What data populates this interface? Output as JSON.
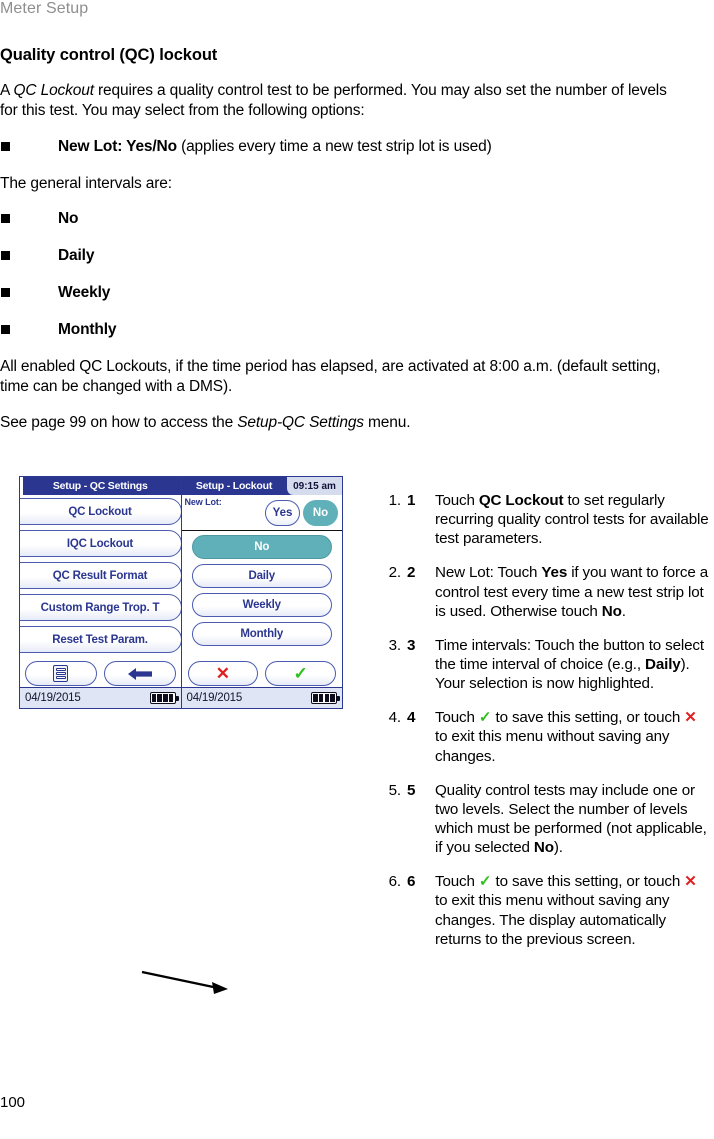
{
  "header": {
    "running_title": "Meter Setup"
  },
  "page_number": "100",
  "section": {
    "title": "Quality control (QC) lockout",
    "intro_a": "A ",
    "intro_italic": "QC Lockout",
    "intro_b": " requires a quality control test to be performed. You may also set the number of levels for this test. You may select from the following options:",
    "bullet_newlot_label": "New Lot: Yes/No",
    "bullet_newlot_tail": " (applies every time a new test strip lot is used)",
    "intervals_lead": "The general intervals are:",
    "intervals": [
      "No",
      "Daily",
      "Weekly",
      "Monthly"
    ],
    "note": "All enabled QC Lockouts, if the time period has elapsed, are activated at 8:00 a.m. (default setting, time can be changed with a DMS).",
    "seealso_a": "See page 99 on how to access the ",
    "seealso_italic": "Setup-QC Settings",
    "seealso_b": " menu."
  },
  "device": {
    "left_screen": {
      "title": "Setup - QC Settings",
      "menu_items": [
        "QC Lockout",
        "IQC Lockout",
        "QC Result Format",
        "Custom Range Trop. T",
        "Reset Test Param."
      ],
      "nav": {
        "list_icon": "list-icon",
        "back_icon": "back-arrow-icon"
      },
      "status": {
        "date": "04/19/2015",
        "battery_icon": "battery-full-icon"
      }
    },
    "right_screen": {
      "title": "Setup - Lockout",
      "clock": "09:15 am",
      "new_lot_label": "New Lot:",
      "new_lot_options": [
        {
          "label": "Yes",
          "selected": false
        },
        {
          "label": "No",
          "selected": true
        }
      ],
      "interval_options": [
        {
          "label": "No",
          "selected": true
        },
        {
          "label": "Daily",
          "selected": false
        },
        {
          "label": "Weekly",
          "selected": false
        },
        {
          "label": "Monthly",
          "selected": false
        }
      ],
      "confirm": {
        "cancel_icon": "red-x-icon",
        "accept_icon": "green-check-icon"
      },
      "status": {
        "date": "04/19/2015",
        "battery_icon": "battery-full-icon"
      }
    },
    "callout_icon": "callout-arrow-icon"
  },
  "steps": [
    {
      "num": "1",
      "parts": [
        {
          "t": "Touch "
        },
        {
          "t": "QC Lockout",
          "b": true
        },
        {
          "t": " to set regularly recurring quality control tests for available test parameters."
        }
      ]
    },
    {
      "num": "2",
      "parts": [
        {
          "t": "New Lot: Touch "
        },
        {
          "t": "Yes",
          "b": true
        },
        {
          "t": " if you want to force a control test every time a new test strip lot is used. Otherwise touch "
        },
        {
          "t": "No",
          "b": true
        },
        {
          "t": "."
        }
      ]
    },
    {
      "num": "3",
      "parts": [
        {
          "t": "Time intervals: Touch the button to select the time interval of choice  (e.g., "
        },
        {
          "t": "Daily",
          "b": true
        },
        {
          "t": "). Your selection is now highlighted."
        }
      ]
    },
    {
      "num": "4",
      "parts": [
        {
          "t": "Touch "
        },
        {
          "t": "✓",
          "ck": true
        },
        {
          "t": " to save this setting, or touch "
        },
        {
          "t": "✕",
          "xx": true
        },
        {
          "t": " to exit this menu without saving any changes."
        }
      ]
    },
    {
      "num": "5",
      "parts": [
        {
          "t": "Quality control tests may include one or two levels. Select the number of levels which must be performed (not applicable, if you selected "
        },
        {
          "t": "No",
          "b": true
        },
        {
          "t": ")."
        }
      ]
    },
    {
      "num": "6",
      "parts": [
        {
          "t": "Touch "
        },
        {
          "t": "✓",
          "ck": true
        },
        {
          "t": " to save this setting, or touch "
        },
        {
          "t": "✕",
          "xx": true
        },
        {
          "t": " to exit this menu without saving any changes. The display automatically returns to the previous screen."
        }
      ]
    }
  ],
  "colors": {
    "header_blue": "#2b3690",
    "teal_selected": "#5fb0b8",
    "status_bar": "#dfe5f4",
    "green_check": "#2fbf1f",
    "red_x": "#e02020",
    "running_header_gray": "#8e8e8e"
  }
}
